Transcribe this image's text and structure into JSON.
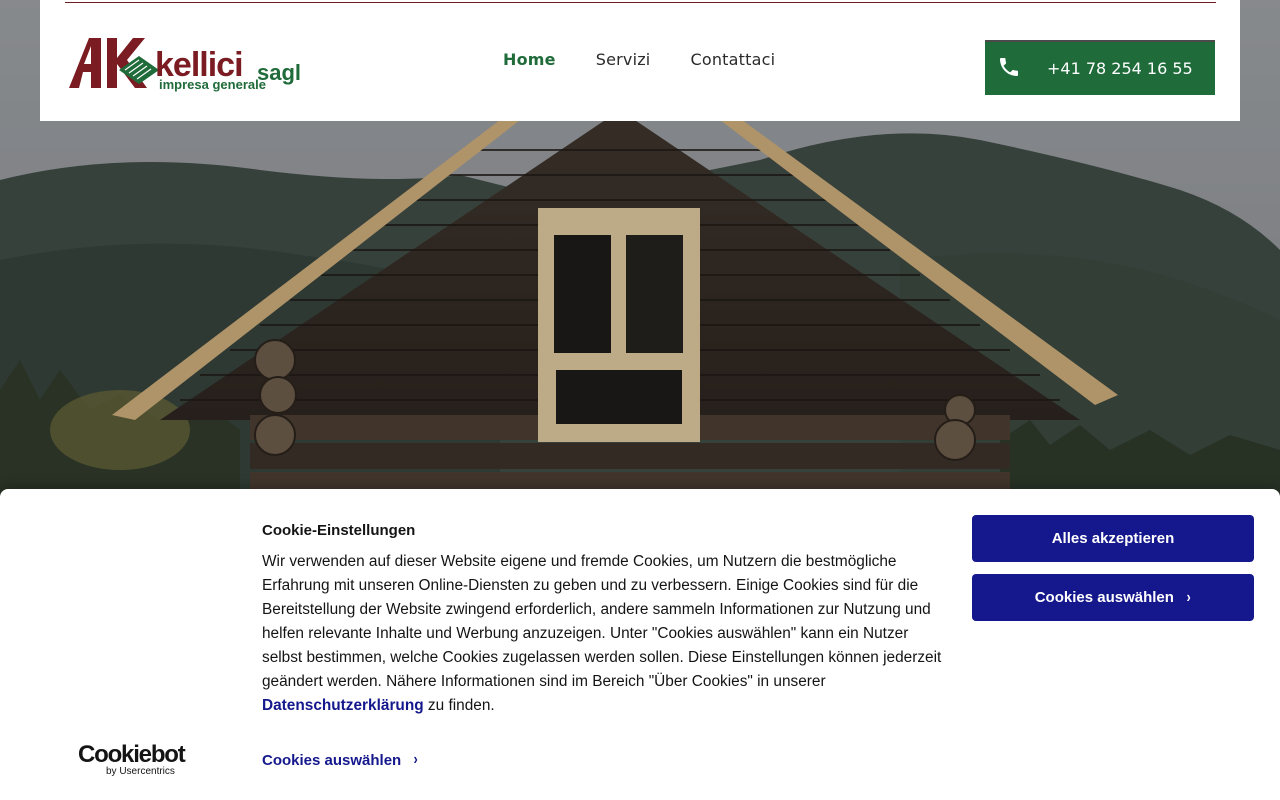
{
  "header": {
    "logo": {
      "mark": "AK",
      "name": "kellici",
      "suffix": "sagl",
      "tagline": "impresa generale"
    },
    "nav": [
      {
        "label": "Home",
        "active": true
      },
      {
        "label": "Servizi",
        "active": false
      },
      {
        "label": "Contattaci",
        "active": false
      }
    ],
    "phone": {
      "icon": "phone-icon",
      "number": "+41 78 254 16 55"
    }
  },
  "cookie_banner": {
    "title": "Cookie-Einstellungen",
    "body_text": "Wir verwenden auf dieser Website eigene und fremde Cookies, um Nutzern die bestmögliche Erfahrung mit unseren Online-Diensten zu geben und zu verbessern. Einige Cookies sind für die Bereitstellung der Website zwingend erforderlich, andere sammeln Informationen zur Nutzung und helfen relevante Inhalte und Werbung anzuzeigen. Unter \"Cookies auswählen\" kann ein Nutzer selbst bestimmen, welche Cookies zugelassen werden sollen. Diese Einstellungen können jederzeit geändert werden. Nähere Informationen sind im Bereich \"Über Cookies\" in unserer",
    "privacy_link": "Datenschutzerklärung",
    "body_end": " zu finden.",
    "accept_label": "Alles akzeptieren",
    "select_label": "Cookies auswählen",
    "select_link_label": "Cookies auswählen",
    "brand": {
      "name": "Cookiebot",
      "by": "by Usercentrics"
    }
  },
  "colors": {
    "brand_green": "#1f6b3a",
    "brand_red": "#7a1c22",
    "cookie_button": "#15178c"
  }
}
